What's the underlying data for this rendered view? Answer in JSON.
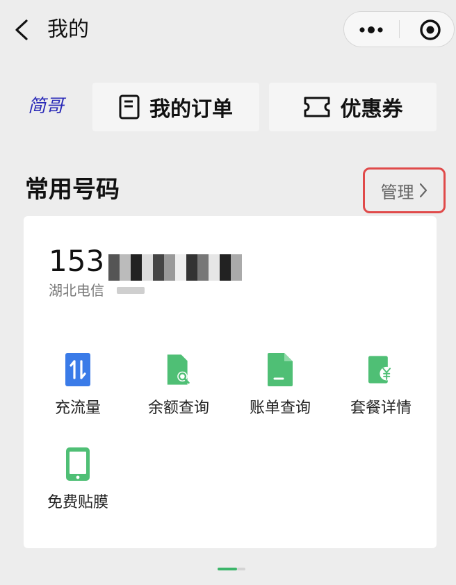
{
  "header": {
    "title": "我的",
    "back_icon": "chevron-left-icon",
    "more_icon": "more-dots-icon",
    "close_icon": "target-close-icon"
  },
  "logo": {
    "text": "简哥",
    "color": "#2b2bb8"
  },
  "top_buttons": [
    {
      "label": "我的订单",
      "icon": "document-icon"
    },
    {
      "label": "优惠券",
      "icon": "ticket-icon"
    }
  ],
  "section": {
    "title": "常用号码",
    "manage_label": "管理",
    "highlight_color": "#e04a4a"
  },
  "number_card": {
    "phone_prefix": "153",
    "carrier": "湖北电信"
  },
  "services": [
    {
      "label": "充流量",
      "icon": "data-transfer-icon",
      "color": "#3a7be8"
    },
    {
      "label": "余额查询",
      "icon": "balance-search-icon",
      "color": "#4fbf75"
    },
    {
      "label": "账单查询",
      "icon": "bill-icon",
      "color": "#4fbf75"
    },
    {
      "label": "套餐详情",
      "icon": "plan-yuan-icon",
      "color": "#4fbf75"
    },
    {
      "label": "免费贴膜",
      "icon": "phone-icon",
      "color": "#4fbf75"
    }
  ],
  "colors": {
    "accent": "#3cb56a",
    "background": "#ededed"
  }
}
